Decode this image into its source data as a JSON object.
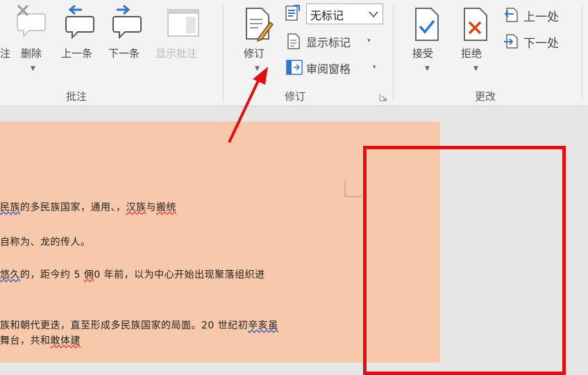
{
  "ribbon": {
    "comments": {
      "partial_label": "注",
      "delete_label": "删除",
      "prev_label": "上一条",
      "next_label": "下一条",
      "show_comments_label": "显示批注",
      "group_label": "批注"
    },
    "tracking": {
      "track_changes_label": "修订",
      "markup_select_value": "无标记",
      "show_markup_label": "显示标记",
      "review_pane_label": "审阅窗格",
      "group_label": "修订"
    },
    "changes": {
      "accept_label": "接受",
      "reject_label": "拒绝",
      "previous_label": "上一处",
      "next_label": "下一处",
      "group_label": "更改"
    }
  },
  "document": {
    "line1": {
      "a": "民族",
      "b": "的多民族国家，通用、，",
      "c": "汉族",
      "d": "与",
      "e": "搬统"
    },
    "line2": "自称为、龙的传人。",
    "line3": {
      "a": "",
      "b": "悠久",
      "c": "的，距今约 5 ",
      "d": "佣",
      "e": "0 年前，以为中心开始出现聚落组织进"
    },
    "line4": {
      "a": "族和朝代更迭，直至形成多民族国家的局面。20 世纪初",
      "b": "辛亥虽"
    },
    "line5": {
      "a": "舞台，共和",
      "b": "敢体建"
    }
  },
  "colors": {
    "page_bg": "#f8c8ab",
    "highlight_box": "#e01010",
    "arrow": "#e01010"
  }
}
